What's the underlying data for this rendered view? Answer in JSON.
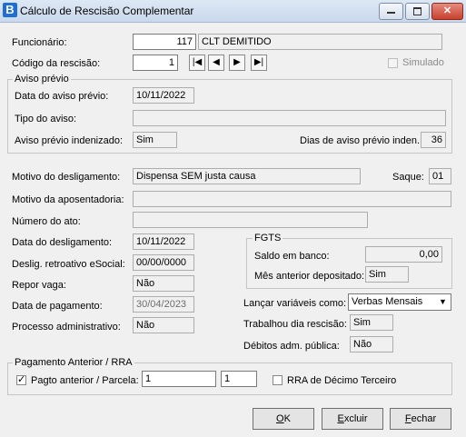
{
  "window": {
    "title": "Cálculo de Rescisão Complementar",
    "app_icon_letter": "B",
    "minimize_glyph": "▭",
    "maximize_glyph": "□",
    "close_glyph": "✕"
  },
  "employee": {
    "label": "Funcionário:",
    "code": "117",
    "name": "CLT DEMITIDO"
  },
  "termination_code": {
    "label": "Código da rescisão:",
    "value": "1",
    "nav_first": "|◀",
    "nav_prev": "◀",
    "nav_next": "▶",
    "nav_last": "▶|"
  },
  "simulated": {
    "label": "Simulado",
    "checked": false
  },
  "notice": {
    "group_title": "Aviso prévio",
    "date_label": "Data do aviso prévio:",
    "date_value": "10/11/2022",
    "type_label": "Tipo do aviso:",
    "type_value": "",
    "indemnified_label": "Aviso prévio indenizado:",
    "indemnified_value": "Sim",
    "days_label": "Dias de aviso prévio inden.:",
    "days_value": "36"
  },
  "dismissal": {
    "reason_label": "Motivo do desligamento:",
    "reason_value": "Dispensa SEM justa causa",
    "saque_label": "Saque:",
    "saque_value": "01",
    "retirement_label": "Motivo da aposentadoria:",
    "retirement_value": "",
    "act_number_label": "Número do ato:",
    "act_number_value": "",
    "date_label": "Data do desligamento:",
    "date_value": "10/11/2022",
    "retro_label": "Deslig. retroativo eSocial:",
    "retro_value": "00/00/0000",
    "repor_label": "Repor vaga:",
    "repor_value": "Não",
    "payment_date_label": "Data de pagamento:",
    "payment_date_value": "30/04/2023",
    "admin_process_label": "Processo administrativo:",
    "admin_process_value": "Não"
  },
  "fgts": {
    "group_title": "FGTS",
    "balance_label": "Saldo em banco:",
    "balance_value": "0,00",
    "prev_month_label": "Mês anterior depositado:",
    "prev_month_value": "Sim"
  },
  "variables": {
    "label": "Lançar variáveis como:",
    "selected": "Verbas Mensais",
    "worked_label": "Trabalhou dia rescisão:",
    "worked_value": "Sim",
    "debts_label": "Débitos adm. pública:",
    "debts_value": "Não"
  },
  "previous_payment": {
    "group_title": "Pagamento Anterior / RRA",
    "pagto_label": "Pagto anterior / Parcela:",
    "pagto_checked": true,
    "pagto_value": "1",
    "parcela_value": "1",
    "rra_label": "RRA de Décimo Terceiro",
    "rra_checked": false
  },
  "buttons": {
    "ok_mnemonic": "O",
    "ok_rest": "K",
    "excluir_mnemonic": "E",
    "excluir_rest": "xcluir",
    "fechar_mnemonic": "F",
    "fechar_rest": "echar"
  }
}
